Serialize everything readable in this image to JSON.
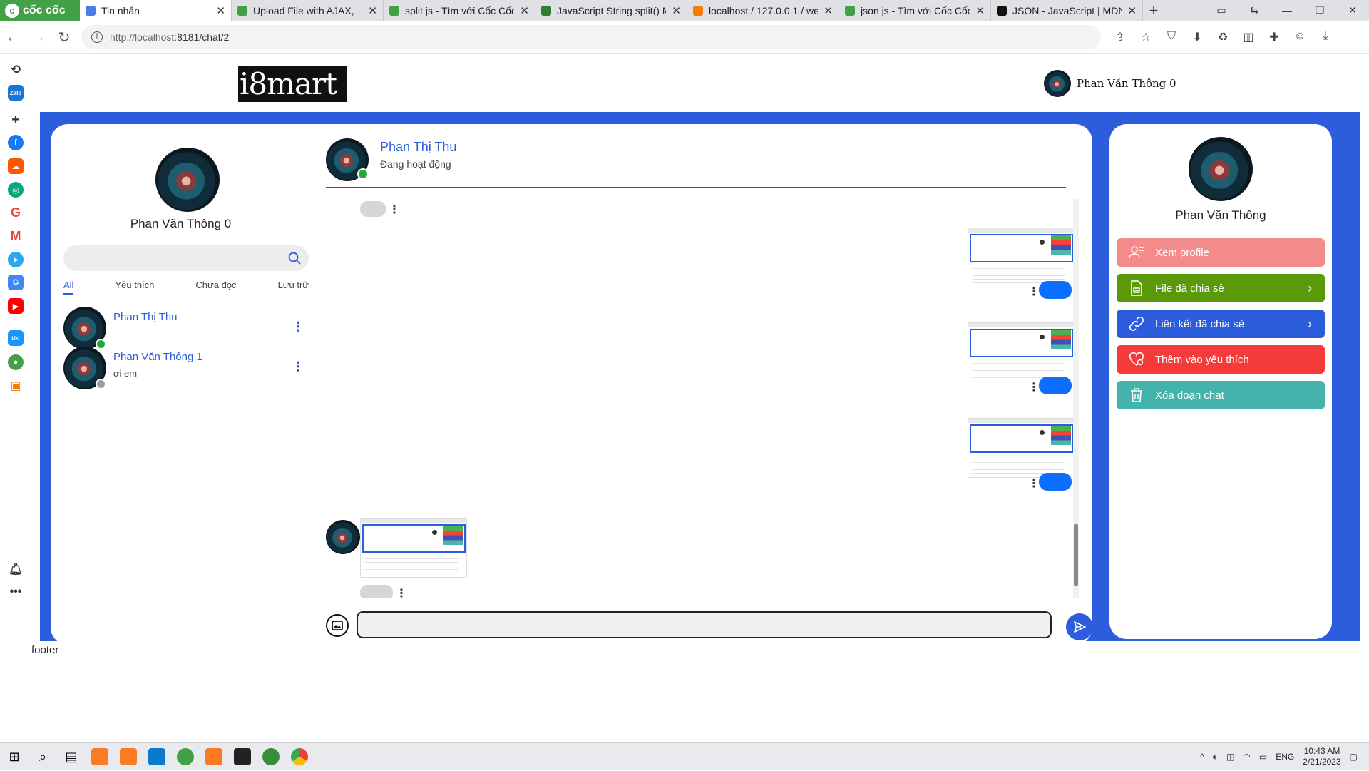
{
  "browser": {
    "brand": "cốc cốc",
    "tabs": [
      {
        "title": "Tin nhắn",
        "fav_color": "#4a7ce8",
        "active": true
      },
      {
        "title": "Upload File with AJAX,",
        "fav_color": "#43a047",
        "active": false
      },
      {
        "title": "split js - Tìm với Cốc Cốc",
        "fav_color": "#43a047",
        "active": false
      },
      {
        "title": "JavaScript String split() M",
        "fav_color": "#2e7d32",
        "active": false
      },
      {
        "title": "localhost / 127.0.0.1 / we",
        "fav_color": "#f57c00",
        "active": false
      },
      {
        "title": "json js - Tìm với Cốc Cốc",
        "fav_color": "#43a047",
        "active": false
      },
      {
        "title": "JSON - JavaScript | MDN",
        "fav_color": "#111111",
        "active": false
      }
    ],
    "url_host": "http://localhost",
    "url_rest": ":8181/chat/2"
  },
  "site": {
    "logo": "i8mart",
    "current_user": "Phan Văn Thông 0"
  },
  "sidebar_profile": {
    "name": "Phan Văn Thông 0",
    "search_placeholder": ""
  },
  "filters": [
    "All",
    "Yêu thích",
    "Chưa đọc",
    "Lưu trữ"
  ],
  "contacts": [
    {
      "name": "Phan Thị Thu",
      "last_message": "",
      "online": true
    },
    {
      "name": "Phan Văn Thông 1",
      "last_message": "ơi em",
      "online": false
    }
  ],
  "chat": {
    "partner_name": "Phan Thị Thu",
    "partner_status": "Đang hoạt động",
    "input_placeholder": ""
  },
  "profile_panel": {
    "name": "Phan Văn Thông",
    "actions": [
      {
        "label": "Xem profile",
        "color": "#f48b8b",
        "icon": "user-list-icon",
        "chevron": false
      },
      {
        "label": "File đã chia sẻ",
        "color": "#5a9a08",
        "icon": "file-image-icon",
        "chevron": true
      },
      {
        "label": "Liên kết đã chia sẻ",
        "color": "#2c5ddd",
        "icon": "link-icon",
        "chevron": true
      },
      {
        "label": "Thêm vào yêu thích",
        "color": "#f53a3a",
        "icon": "heart-add-icon",
        "chevron": false
      },
      {
        "label": "Xóa đoạn chat",
        "color": "#45b3ad",
        "icon": "trash-icon",
        "chevron": false
      }
    ]
  },
  "footer": "footer",
  "taskbar": {
    "lang": "ENG",
    "time": "10:43 AM",
    "date": "2/21/2023"
  },
  "colors": {
    "accent": "#2c5ddd",
    "online": "#22a935",
    "offline": "#9e9e9e",
    "bubble_out": "#0d6efd"
  }
}
